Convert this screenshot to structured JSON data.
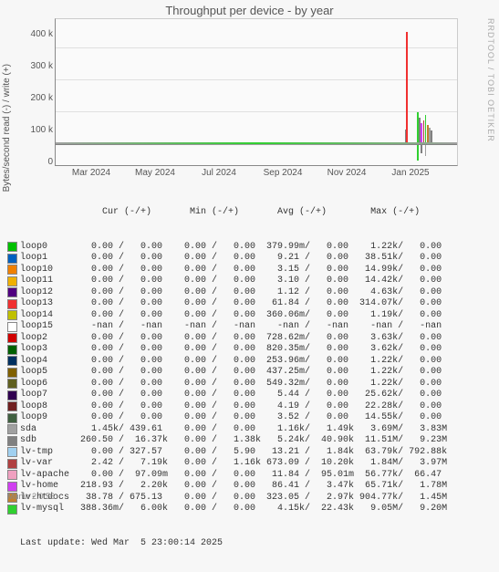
{
  "title": "Throughput per device - by year",
  "watermark": "RRDTOOL / TOBI OETIKER",
  "ylabel": "Bytes/second read (-) / write (+)",
  "footer_left": "Munin 2.0.56",
  "last_update": "Last update: Wed Mar  5 23:00:14 2025",
  "chart_data": {
    "type": "line",
    "x_ticks": [
      "Mar 2024",
      "May 2024",
      "Jul 2024",
      "Sep 2024",
      "Nov 2024",
      "Jan 2025"
    ],
    "y_ticks": [
      0,
      "100 k",
      "200 k",
      "300 k",
      "400 k"
    ],
    "ylim": [
      -40000,
      400000
    ],
    "xlabel": "",
    "note": "Mostly flat near zero; large activity spike around Jan–Feb 2025 reaching ~340k with smaller multi-colored spikes"
  },
  "legend_header": "               Cur (-/+)       Min (-/+)       Avg (-/+)        Max (-/+)",
  "devices": [
    {
      "name": "loop0",
      "color": "#00c000",
      "row": "loop0        0.00 /   0.00    0.00 /   0.00  379.99m/   0.00    1.22k/   0.00"
    },
    {
      "name": "loop1",
      "color": "#0060c0",
      "row": "loop1        0.00 /   0.00    0.00 /   0.00    9.21 /   0.00   38.51k/   0.00"
    },
    {
      "name": "loop10",
      "color": "#f08000",
      "row": "loop10       0.00 /   0.00    0.00 /   0.00    3.15 /   0.00   14.99k/   0.00"
    },
    {
      "name": "loop11",
      "color": "#f0b000",
      "row": "loop11       0.00 /   0.00    0.00 /   0.00    3.10 /   0.00   14.42k/   0.00"
    },
    {
      "name": "loop12",
      "color": "#500080",
      "row": "loop12       0.00 /   0.00    0.00 /   0.00    1.12 /   0.00    4.63k/   0.00"
    },
    {
      "name": "loop13",
      "color": "#f03030",
      "row": "loop13       0.00 /   0.00    0.00 /   0.00   61.84 /   0.00  314.07k/   0.00"
    },
    {
      "name": "loop14",
      "color": "#c0c000",
      "row": "loop14       0.00 /   0.00    0.00 /   0.00  360.06m/   0.00    1.19k/   0.00"
    },
    {
      "name": "loop15",
      "color": "#ffffff",
      "row": "loop15       -nan /   -nan    -nan /   -nan    -nan /   -nan    -nan /   -nan"
    },
    {
      "name": "loop2",
      "color": "#d00000",
      "row": "loop2        0.00 /   0.00    0.00 /   0.00  728.62m/   0.00    3.63k/   0.00"
    },
    {
      "name": "loop3",
      "color": "#006000",
      "row": "loop3        0.00 /   0.00    0.00 /   0.00  820.35m/   0.00    3.62k/   0.00"
    },
    {
      "name": "loop4",
      "color": "#003060",
      "row": "loop4        0.00 /   0.00    0.00 /   0.00  253.96m/   0.00    1.22k/   0.00"
    },
    {
      "name": "loop5",
      "color": "#806000",
      "row": "loop5        0.00 /   0.00    0.00 /   0.00  437.25m/   0.00    1.22k/   0.00"
    },
    {
      "name": "loop6",
      "color": "#606020",
      "row": "loop6        0.00 /   0.00    0.00 /   0.00  549.32m/   0.00    1.22k/   0.00"
    },
    {
      "name": "loop7",
      "color": "#300050",
      "row": "loop7        0.00 /   0.00    0.00 /   0.00    5.44 /   0.00   25.62k/   0.00"
    },
    {
      "name": "loop8",
      "color": "#702020",
      "row": "loop8        0.00 /   0.00    0.00 /   0.00    4.19 /   0.00   22.28k/   0.00"
    },
    {
      "name": "loop9",
      "color": "#406040",
      "row": "loop9        0.00 /   0.00    0.00 /   0.00    3.52 /   0.00   14.55k/   0.00"
    },
    {
      "name": "sda",
      "color": "#a0a0a0",
      "row": "sda          1.45k/ 439.61    0.00 /   0.00    1.16k/   1.49k   3.69M/   3.83M"
    },
    {
      "name": "sdb",
      "color": "#808080",
      "row": "sdb        260.50 /  16.37k   0.00 /   1.38k   5.24k/  40.90k  11.51M/   9.23M"
    },
    {
      "name": "lv-tmp",
      "color": "#a0d0f0",
      "row": "lv-tmp       0.00 / 327.57    0.00 /   5.90   13.21 /   1.84k  63.79k/ 792.88k"
    },
    {
      "name": "lv-var",
      "color": "#b04040",
      "row": "lv-var       2.42 /   7.19k   0.00 /   1.16k 673.09 /  10.20k   1.84M/   3.97M"
    },
    {
      "name": "lv-apache",
      "color": "#f0a0c0",
      "row": "lv-apache    0.00 /  97.09m   0.00 /   0.00   11.84 /  95.01m  56.77k/  66.47"
    },
    {
      "name": "lv-home",
      "color": "#d040f0",
      "row": "lv-home    218.93 /   2.20k   0.00 /   0.00   86.41 /   3.47k  65.71k/   1.78M"
    },
    {
      "name": "lv-htdocs",
      "color": "#c08030",
      "row": "lv-htdocs   38.78 / 675.13    0.00 /   0.00  323.05 /   2.97k 904.77k/   1.45M"
    },
    {
      "name": "lv-mysql",
      "color": "#30d030",
      "row": "lv-mysql   388.36m/   6.00k   0.00 /   0.00    4.15k/  22.43k   9.05M/   9.20M"
    }
  ]
}
